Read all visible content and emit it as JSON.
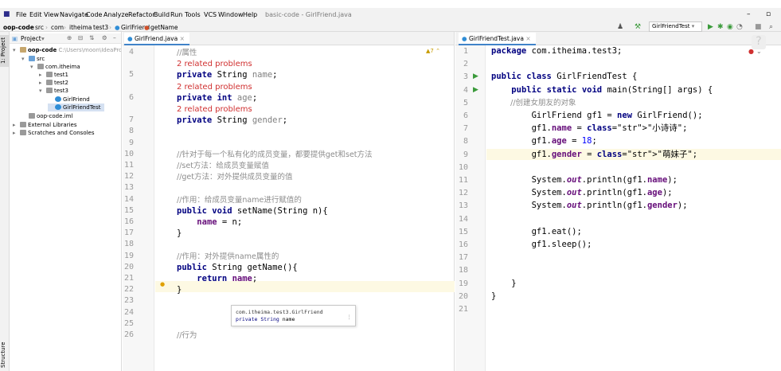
{
  "window": {
    "title": "basic-code - GirlFriend.java"
  },
  "menu": [
    "File",
    "Edit",
    "View",
    "Navigate",
    "Code",
    "Analyze",
    "Refactor",
    "Build",
    "Run",
    "Tools",
    "VCS",
    "Window",
    "Help"
  ],
  "breadcrumbs": [
    "oop-code",
    "src",
    "com",
    "itheima",
    "test3",
    "GirlFriend",
    "getName"
  ],
  "run_config": "GirlFriendTest",
  "left_strip": {
    "project_tab": "1: Project",
    "structure_tab": "Structure"
  },
  "project": {
    "header": "Project",
    "tree": [
      {
        "label": "oop-code",
        "detail": "C:\\Users\\moon\\IdeaProjects\\basic-code\\oop-code",
        "depth": 0,
        "icon": "folder",
        "expanded": true
      },
      {
        "label": "src",
        "depth": 1,
        "icon": "src-folder",
        "expanded": true
      },
      {
        "label": "com.itheima",
        "depth": 2,
        "icon": "package",
        "expanded": true
      },
      {
        "label": "test1",
        "depth": 3,
        "icon": "package",
        "expanded": false
      },
      {
        "label": "test2",
        "depth": 3,
        "icon": "package",
        "expanded": false
      },
      {
        "label": "test3",
        "depth": 3,
        "icon": "package",
        "expanded": true
      },
      {
        "label": "GirlFriend",
        "depth": 4,
        "icon": "class"
      },
      {
        "label": "GirlFriendTest",
        "depth": 4,
        "icon": "class",
        "selected": true
      },
      {
        "label": "oop-code.iml",
        "depth": 1,
        "icon": "file"
      },
      {
        "label": "External Libraries",
        "depth": 0,
        "icon": "library",
        "expanded": false
      },
      {
        "label": "Scratches and Consoles",
        "depth": 0,
        "icon": "scratch",
        "expanded": false
      }
    ]
  },
  "editor_left": {
    "tab": "GirlFriend.java",
    "warning_count": "7",
    "lines": [
      {
        "num": "4",
        "kind": "comment",
        "text": "//属性"
      },
      {
        "kind": "problem",
        "text": "2 related problems"
      },
      {
        "num": "5",
        "kind": "field",
        "mod": "private",
        "type": "String",
        "name": "name"
      },
      {
        "kind": "problem",
        "text": "2 related problems"
      },
      {
        "num": "6",
        "kind": "field",
        "mod": "private",
        "type": "int",
        "name": "age"
      },
      {
        "kind": "problem",
        "text": "2 related problems"
      },
      {
        "num": "7",
        "kind": "field",
        "mod": "private",
        "type": "String",
        "name": "gender"
      },
      {
        "num": "8"
      },
      {
        "num": "9"
      },
      {
        "num": "10",
        "kind": "comment",
        "text": "//针对于每一个私有化的成员变量，都要提供get和set方法"
      },
      {
        "num": "11",
        "kind": "comment",
        "text": "//set方法：给成员变量赋值"
      },
      {
        "num": "12",
        "kind": "comment",
        "text": "//get方法：对外提供成员变量的值"
      },
      {
        "num": "13"
      },
      {
        "num": "14",
        "kind": "comment",
        "text": "//作用：给成员变量name进行赋值的"
      },
      {
        "num": "15",
        "kind": "code",
        "text": "public void setName(String n){"
      },
      {
        "num": "16",
        "kind": "code",
        "text": "    name = n;"
      },
      {
        "num": "17",
        "kind": "code",
        "text": "}"
      },
      {
        "num": "18"
      },
      {
        "num": "19",
        "kind": "comment",
        "text": "//作用：对外提供name属性的"
      },
      {
        "num": "20",
        "kind": "code",
        "text": "public String getName(){"
      },
      {
        "num": "21",
        "kind": "code",
        "text": "    return name;"
      },
      {
        "num": "22",
        "kind": "code",
        "text": "}"
      },
      {
        "num": "23"
      },
      {
        "num": "24"
      },
      {
        "num": "25"
      },
      {
        "num": "26",
        "kind": "comment",
        "text": "//行为"
      }
    ],
    "popup": {
      "line1": "com.itheima.test3.GirlFriend",
      "line2_mod": "private",
      "line2_type": "String",
      "line2_name": "name"
    }
  },
  "editor_right": {
    "tab": "GirlFriendTest.java",
    "lines": [
      {
        "num": "1",
        "text": "package com.itheima.test3;"
      },
      {
        "num": "2",
        "text": ""
      },
      {
        "num": "3",
        "text": "public class GirlFriendTest {"
      },
      {
        "num": "4",
        "text": "    public static void main(String[] args) {"
      },
      {
        "num": "5",
        "text": "        //创建女朋友的对象"
      },
      {
        "num": "6",
        "text": "        GirlFriend gf1 = new GirlFriend();"
      },
      {
        "num": "7",
        "text": "        gf1.name = \"小诗诗\";"
      },
      {
        "num": "8",
        "text": "        gf1.age = 18;"
      },
      {
        "num": "9",
        "text": "        gf1.gender = \"萌妹子\";"
      },
      {
        "num": "10",
        "text": ""
      },
      {
        "num": "11",
        "text": "        System.out.println(gf1.name);"
      },
      {
        "num": "12",
        "text": "        System.out.println(gf1.age);"
      },
      {
        "num": "13",
        "text": "        System.out.println(gf1.gender);"
      },
      {
        "num": "14",
        "text": ""
      },
      {
        "num": "15",
        "text": "        gf1.eat();"
      },
      {
        "num": "16",
        "text": "        gf1.sleep();"
      },
      {
        "num": "17",
        "text": ""
      },
      {
        "num": "18",
        "text": ""
      },
      {
        "num": "19",
        "text": "    }"
      },
      {
        "num": "20",
        "text": "}"
      },
      {
        "num": "21",
        "text": ""
      }
    ]
  },
  "colors": {
    "keyword": "#000080",
    "comment": "#8c8c8c",
    "field": "#660e7a",
    "string": "#008000",
    "number": "#0000ff",
    "problem": "#d03030",
    "accent": "#4083c9",
    "line_highlight": "#fdf9e3"
  }
}
